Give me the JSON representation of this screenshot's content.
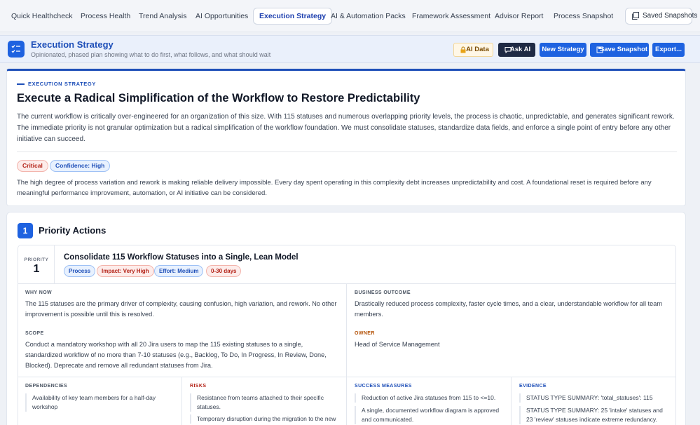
{
  "nav": {
    "tabs": [
      {
        "label": "Quick Healthcheck"
      },
      {
        "label": "Process Health"
      },
      {
        "label": "Trend Analysis"
      },
      {
        "label": "AI Opportunities"
      },
      {
        "label": "Execution Strategy"
      },
      {
        "label": "AI & Automation Packs"
      },
      {
        "label": "Framework Assessment"
      },
      {
        "label": "Advisor Report"
      },
      {
        "label": "Process Snapshot"
      }
    ],
    "active_tab": "Execution Strategy",
    "saved_label": "Saved Snapshots"
  },
  "header": {
    "title": "Execution Strategy",
    "subtitle": "Opinionated, phased plan showing what to do first, what follows, and what should wait",
    "buttons": {
      "ai_data": "AI Data",
      "ask_ai": "Ask AI",
      "new_strategy": "New Strategy",
      "save_snapshot": "Save Snapshot",
      "export": "Export..."
    }
  },
  "strategy": {
    "eyebrow": "EXECUTION STRATEGY",
    "title": "Execute a Radical Simplification of the Workflow to Restore Predictability",
    "body": "The current workflow is critically over-engineered for an organization of this size. With 115 statuses and numerous overlapping priority levels, the process is chaotic, unpredictable, and generates significant rework. The immediate priority is not granular optimization but a radical simplification of the workflow foundation. We must consolidate statuses, standardize data fields, and enforce a single point of entry before any other initiative can succeed.",
    "severity": "Critical",
    "confidence": "Confidence: High",
    "note": "The high degree of process variation and rework is making reliable delivery impossible. Every day spent operating in this complexity debt increases unpredictability and cost. A foundational reset is required before any meaningful performance improvement, automation, or AI initiative can be considered."
  },
  "priority_actions": {
    "number": "1",
    "title": "Priority Actions",
    "items": [
      {
        "priority_label": "PRIORITY",
        "priority": "1",
        "title": "Consolidate 115 Workflow Statuses into a Single, Lean Model",
        "tags": {
          "category": "Process",
          "impact": "Impact: Very High",
          "effort": "Effort: Medium",
          "timeline": "0-30 days"
        },
        "why_now_label": "WHY NOW",
        "why_now": "The 115 statuses are the primary driver of complexity, causing confusion, high variation, and rework. No other improvement is possible until this is resolved.",
        "business_outcome_label": "BUSINESS OUTCOME",
        "business_outcome": "Drastically reduced process complexity, faster cycle times, and a clear, understandable workflow for all team members.",
        "scope_label": "SCOPE",
        "scope": "Conduct a mandatory workshop with all 20 Jira users to map the 115 existing statuses to a single, standardized workflow of no more than 7-10 statuses (e.g., Backlog, To Do, In Progress, In Review, Done, Blocked). Deprecate and remove all redundant statuses from Jira.",
        "owner_label": "OWNER",
        "owner": "Head of Service Management",
        "dependencies_label": "DEPENDENCIES",
        "dependencies": [
          "Availability of key team members for a half-day workshop"
        ],
        "risks_label": "RISKS",
        "risks": [
          "Resistance from teams attached to their specific statuses.",
          "Temporary disruption during the migration to the new"
        ],
        "success_label": "SUCCESS MEASURES",
        "success": [
          "Reduction of active Jira statuses from 115 to <=10.",
          "A single, documented workflow diagram is approved and communicated."
        ],
        "evidence_label": "EVIDENCE",
        "evidence": [
          "STATUS TYPE SUMMARY: 'total_statuses': 115",
          "STATUS TYPE SUMMARY: 25 'intake' statuses and 23 'review' statuses indicate extreme redundancy."
        ]
      }
    ]
  }
}
